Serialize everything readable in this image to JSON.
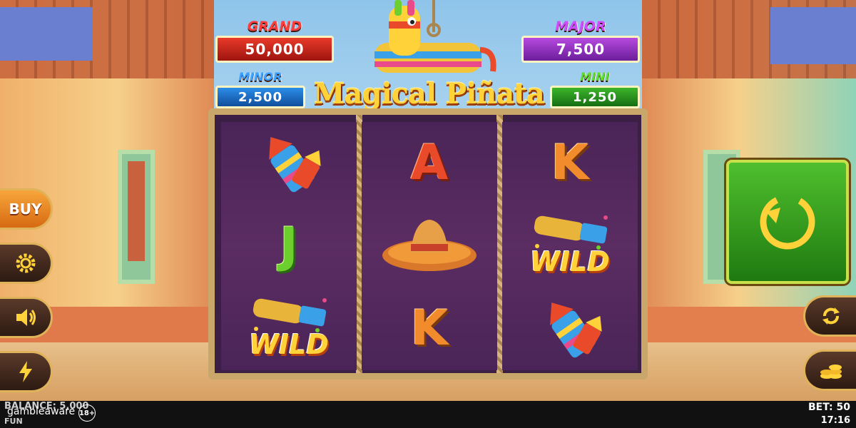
{
  "game": {
    "title": "Magical Piñata"
  },
  "jackpots": {
    "grand": {
      "label": "GRAND",
      "value": "50,000",
      "color": "#e93a2a"
    },
    "major": {
      "label": "MAJOR",
      "value": "7,500",
      "color": "#b64ae0"
    },
    "minor": {
      "label": "MINOR",
      "value": "2,500",
      "color": "#2b8de8"
    },
    "mini": {
      "label": "MINI",
      "value": "1,250",
      "color": "#3cb52a"
    }
  },
  "reels": [
    {
      "symbols": [
        {
          "type": "firework",
          "label": ""
        },
        {
          "type": "letter",
          "label": "J"
        },
        {
          "type": "wild",
          "label": "WILD"
        }
      ]
    },
    {
      "symbols": [
        {
          "type": "letter",
          "label": "A"
        },
        {
          "type": "sombrero",
          "label": ""
        },
        {
          "type": "letter",
          "label": "K"
        }
      ]
    },
    {
      "symbols": [
        {
          "type": "letter",
          "label": "K"
        },
        {
          "type": "wild",
          "label": "WILD"
        },
        {
          "type": "firework",
          "label": ""
        }
      ]
    }
  ],
  "controls": {
    "buy_label": "BUY",
    "settings_icon": "gear-icon",
    "sound_icon": "speaker-icon",
    "turbo_icon": "lightning-icon",
    "spin_icon": "spin-arrow-icon",
    "autoplay_icon": "autoplay-icon",
    "coins_icon": "coins-icon"
  },
  "footer": {
    "balance": "BALANCE: 5,000",
    "mode": "FUN",
    "gamble_aware": "gambleaware",
    "age": "18+",
    "bet": "BET: 50",
    "clock": "17:16"
  }
}
